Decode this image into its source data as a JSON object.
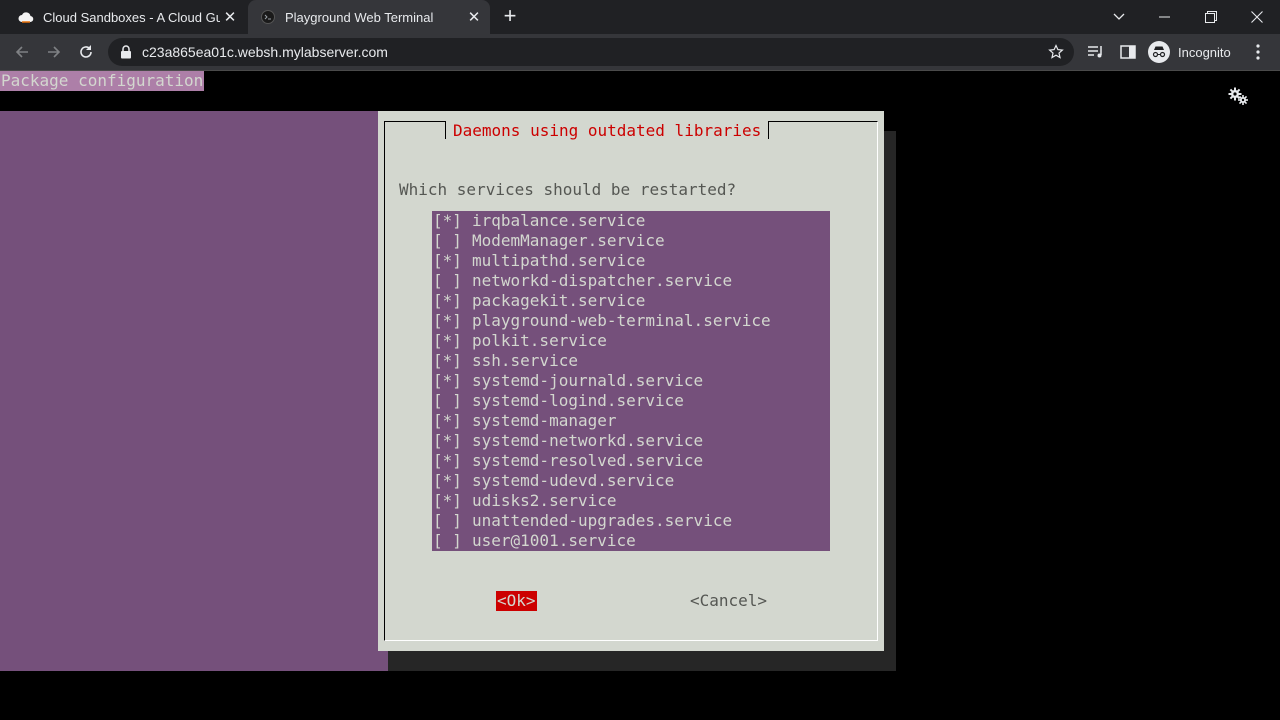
{
  "browser": {
    "tabs": [
      {
        "title": "Cloud Sandboxes - A Cloud Guru",
        "active": false,
        "icon": "cloud-icon"
      },
      {
        "title": "Playground Web Terminal",
        "active": true,
        "icon": "terminal-icon"
      }
    ],
    "url": "c23a865ea01c.websh.mylabserver.com",
    "profile_label": "Incognito"
  },
  "terminal": {
    "header": "Package configuration",
    "dialog": {
      "title": "Daemons using outdated libraries",
      "question": "Which services should be restarted?",
      "items": [
        {
          "mark": "[*]",
          "name": "irqbalance.service"
        },
        {
          "mark": "[ ]",
          "name": "ModemManager.service"
        },
        {
          "mark": "[*]",
          "name": "multipathd.service"
        },
        {
          "mark": "[ ]",
          "name": "networkd-dispatcher.service"
        },
        {
          "mark": "[*]",
          "name": "packagekit.service"
        },
        {
          "mark": "[*]",
          "name": "playground-web-terminal.service"
        },
        {
          "mark": "[*]",
          "name": "polkit.service"
        },
        {
          "mark": "[*]",
          "name": "ssh.service"
        },
        {
          "mark": "[*]",
          "name": "systemd-journald.service"
        },
        {
          "mark": "[ ]",
          "name": "systemd-logind.service"
        },
        {
          "mark": "[*]",
          "name": "systemd-manager"
        },
        {
          "mark": "[*]",
          "name": "systemd-networkd.service"
        },
        {
          "mark": "[*]",
          "name": "systemd-resolved.service"
        },
        {
          "mark": "[*]",
          "name": "systemd-udevd.service"
        },
        {
          "mark": "[*]",
          "name": "udisks2.service"
        },
        {
          "mark": "[ ]",
          "name": "unattended-upgrades.service"
        },
        {
          "mark": "[ ]",
          "name": "user@1001.service"
        }
      ],
      "ok_label": "<Ok>",
      "cancel_label": "<Cancel>"
    }
  },
  "colors": {
    "terminal_bg": "#000000",
    "purple": "#75507b",
    "dialog_bg": "#d3d7cf",
    "accent_red": "#cc0000",
    "text_gray": "#555753"
  }
}
